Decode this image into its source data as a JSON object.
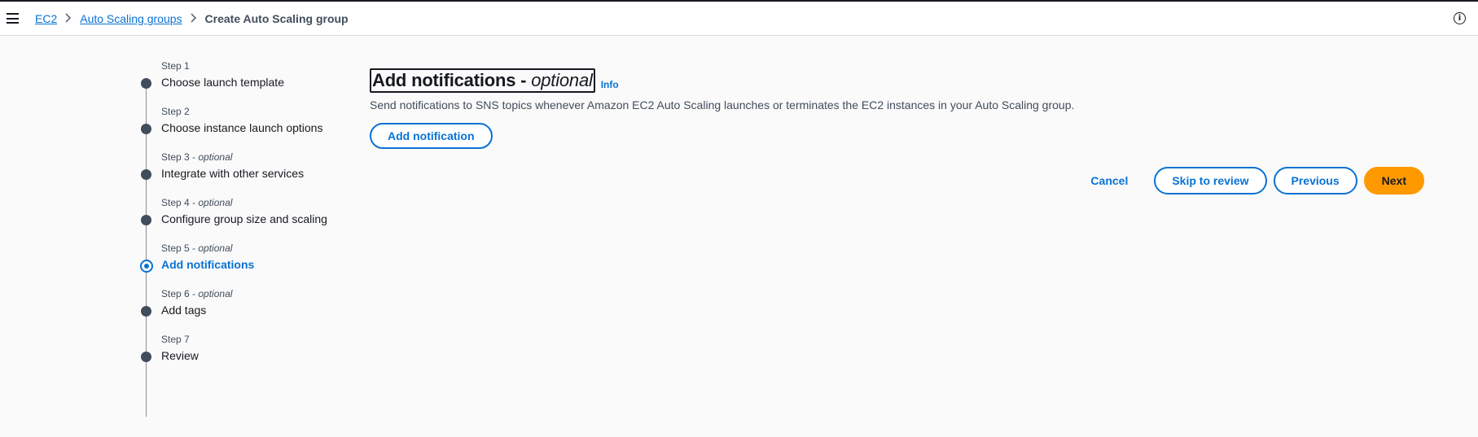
{
  "breadcrumb": {
    "items": [
      {
        "label": "EC2"
      },
      {
        "label": "Auto Scaling groups"
      },
      {
        "label": "Create Auto Scaling group"
      }
    ]
  },
  "header": {
    "info_icon": "ⓘ"
  },
  "steps": [
    {
      "label": "Step 1",
      "optional": "",
      "title": "Choose launch template"
    },
    {
      "label": "Step 2",
      "optional": "",
      "title": "Choose instance launch options"
    },
    {
      "label": "Step 3",
      "optional": "optional",
      "title": "Integrate with other services"
    },
    {
      "label": "Step 4",
      "optional": "optional",
      "title": "Configure group size and scaling"
    },
    {
      "label": "Step 5",
      "optional": "optional",
      "title": "Add notifications"
    },
    {
      "label": "Step 6",
      "optional": "optional",
      "title": "Add tags"
    },
    {
      "label": "Step 7",
      "optional": "",
      "title": "Review"
    }
  ],
  "main": {
    "title": "Add notifications -",
    "title_optional": "optional",
    "info_link": "Info",
    "description": "Send notifications to SNS topics whenever Amazon EC2 Auto Scaling launches or terminates the EC2 instances in your Auto Scaling group.",
    "add_button": "Add notification"
  },
  "actions": {
    "cancel": "Cancel",
    "skip": "Skip to review",
    "previous": "Previous",
    "next": "Next"
  },
  "colors": {
    "accent": "#0972d3",
    "primary_button": "#ff9900"
  }
}
